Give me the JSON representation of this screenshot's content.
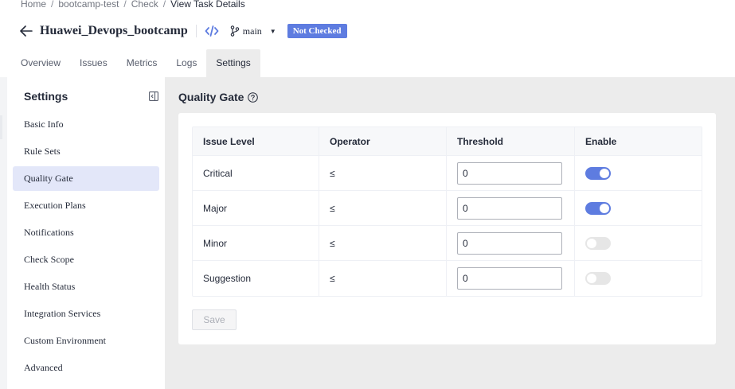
{
  "breadcrumb": {
    "items": [
      "Home",
      "bootcamp-test",
      "Check",
      "View Task Details"
    ],
    "separator": "/"
  },
  "header": {
    "task_name": "Huawei_Devops_bootcamp",
    "branch": "main",
    "status": "Not Checked",
    "status_color": "#5e7ce0"
  },
  "tabs": [
    {
      "label": "Overview",
      "active": false
    },
    {
      "label": "Issues",
      "active": false
    },
    {
      "label": "Metrics",
      "active": false
    },
    {
      "label": "Logs",
      "active": false
    },
    {
      "label": "Settings",
      "active": true
    }
  ],
  "sidebar": {
    "title": "Settings",
    "items": [
      {
        "label": "Basic Info",
        "active": false
      },
      {
        "label": "Rule Sets",
        "active": false
      },
      {
        "label": "Quality Gate",
        "active": true
      },
      {
        "label": "Execution Plans",
        "active": false
      },
      {
        "label": "Notifications",
        "active": false
      },
      {
        "label": "Check Scope",
        "active": false
      },
      {
        "label": "Health Status",
        "active": false
      },
      {
        "label": "Integration Services",
        "active": false
      },
      {
        "label": "Custom Environment",
        "active": false
      },
      {
        "label": "Advanced",
        "active": false
      }
    ]
  },
  "main": {
    "section_title": "Quality Gate",
    "table": {
      "columns": [
        "Issue Level",
        "Operator",
        "Threshold",
        "Enable"
      ],
      "rows": [
        {
          "level": "Critical",
          "operator": "≤",
          "threshold": "0",
          "enabled": true
        },
        {
          "level": "Major",
          "operator": "≤",
          "threshold": "0",
          "enabled": true
        },
        {
          "level": "Minor",
          "operator": "≤",
          "threshold": "0",
          "enabled": false
        },
        {
          "level": "Suggestion",
          "operator": "≤",
          "threshold": "0",
          "enabled": false
        }
      ]
    },
    "save_label": "Save"
  },
  "colors": {
    "accent": "#5e7ce0",
    "active_menu_bg": "#e3e7f9",
    "panel_bg": "#ececec"
  }
}
